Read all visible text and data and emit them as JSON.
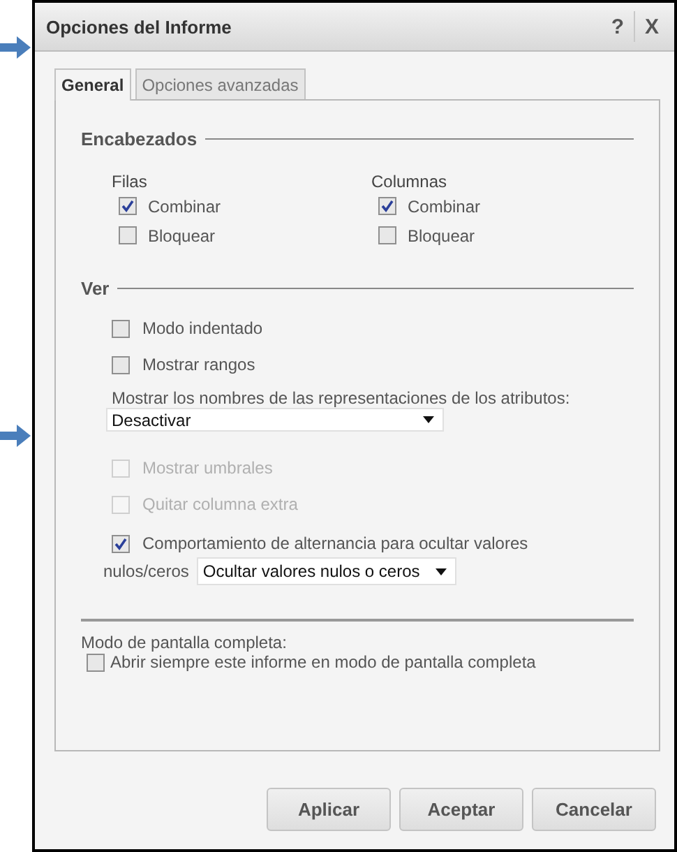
{
  "window": {
    "title": "Opciones del Informe",
    "help": "?",
    "close": "X"
  },
  "tabs": [
    {
      "label": "General",
      "selected": true
    },
    {
      "label": "Opciones avanzadas",
      "selected": false
    }
  ],
  "headers": {
    "title": "Encabezados",
    "groups": [
      {
        "label": "Filas",
        "options": [
          {
            "label": "Combinar",
            "checked": true
          },
          {
            "label": "Bloquear",
            "checked": false
          }
        ]
      },
      {
        "label": "Columnas",
        "options": [
          {
            "label": "Combinar",
            "checked": true
          },
          {
            "label": "Bloquear",
            "checked": false
          }
        ]
      }
    ]
  },
  "view": {
    "title": "Ver",
    "items": [
      {
        "kind": "checkbox",
        "label": "Modo indentado",
        "checked": false,
        "disabled": false
      },
      {
        "kind": "checkbox",
        "label": "Mostrar rangos",
        "checked": false,
        "disabled": false
      },
      {
        "kind": "select",
        "label": "Mostrar los nombres de las representaciones de los atributos:",
        "value": "Desactivar"
      },
      {
        "kind": "checkbox",
        "label": "Mostrar umbrales",
        "checked": false,
        "disabled": true
      },
      {
        "kind": "checkbox",
        "label": "Quitar columna extra",
        "checked": false,
        "disabled": true
      },
      {
        "kind": "checkbox_select",
        "label": "Comportamiento de alternancia para ocultar valores",
        "checked": true,
        "disabled": false,
        "sublabel": "nulos/ceros",
        "value": "Ocultar valores nulos o ceros"
      }
    ]
  },
  "fullscreen": {
    "label": "Modo de pantalla completa:",
    "option": {
      "label": "Abrir siempre este informe en modo de pantalla completa",
      "checked": false
    }
  },
  "buttons": [
    "Aplicar",
    "Aceptar",
    "Cancelar"
  ]
}
